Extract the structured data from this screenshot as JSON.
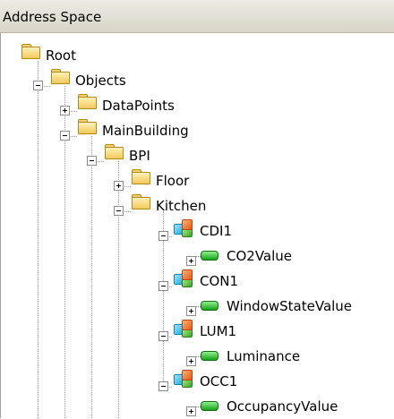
{
  "panel": {
    "title": "Address Space"
  },
  "tree": {
    "root": "Root",
    "objects": "Objects",
    "datapoints": "DataPoints",
    "mainbuilding": "MainBuilding",
    "bpi": "BPI",
    "floor": "Floor",
    "kitchen": "Kitchen",
    "cdi1": "CDI1",
    "co2value": "CO2Value",
    "con1": "CON1",
    "windowstatevalue": "WindowStateValue",
    "lum1": "LUM1",
    "luminance": "Luminance",
    "occ1": "OCC1",
    "occupancyvalue": "OccupancyValue"
  },
  "icons": {
    "folder": "folder-icon",
    "object": "object-icon",
    "variable": "variable-icon",
    "expand": "plus-expander-icon",
    "collapse": "minus-expander-icon"
  }
}
